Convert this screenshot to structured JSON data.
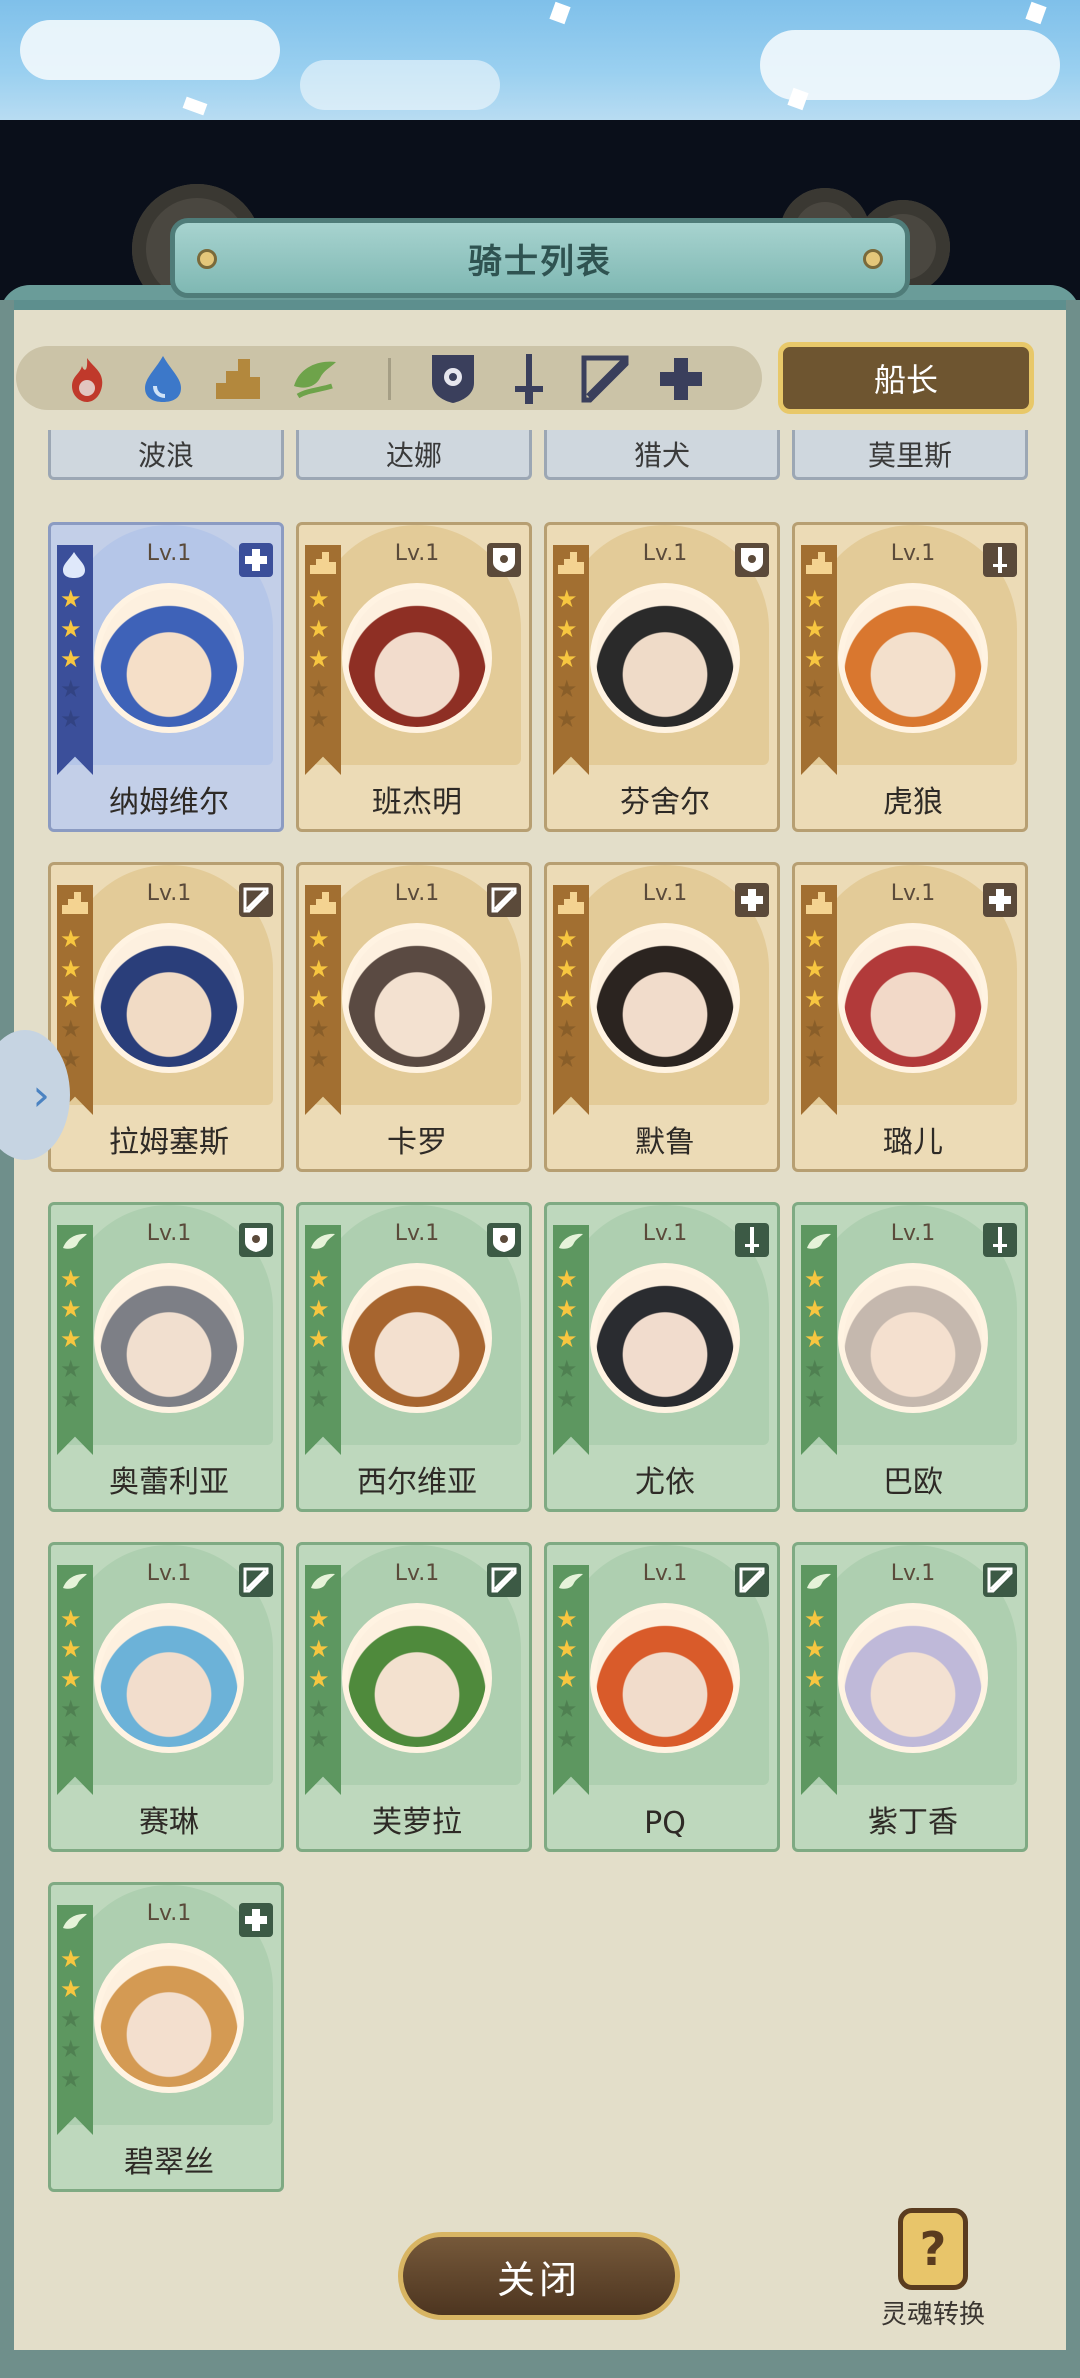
{
  "header": {
    "title": "骑士列表"
  },
  "filters": {
    "elements": [
      "fire-icon",
      "water-icon",
      "earth-icon",
      "wind-icon"
    ],
    "classes": [
      "shield-class-icon",
      "sword-class-icon",
      "bow-class-icon",
      "healer-class-icon"
    ]
  },
  "captain_label": "船长",
  "previous_row": [
    "波浪",
    "达娜",
    "猎犬",
    "莫里斯"
  ],
  "knights": [
    {
      "name": "纳姆维尔",
      "level": "Lv.1",
      "element": "water",
      "class": "healer",
      "stars": 3
    },
    {
      "name": "班杰明",
      "level": "Lv.1",
      "element": "earth",
      "class": "shield",
      "stars": 3
    },
    {
      "name": "芬舍尔",
      "level": "Lv.1",
      "element": "earth",
      "class": "shield",
      "stars": 3
    },
    {
      "name": "虎狼",
      "level": "Lv.1",
      "element": "earth",
      "class": "sword",
      "stars": 3
    },
    {
      "name": "拉姆塞斯",
      "level": "Lv.1",
      "element": "earth",
      "class": "bow",
      "stars": 3
    },
    {
      "name": "卡罗",
      "level": "Lv.1",
      "element": "earth",
      "class": "bow",
      "stars": 3
    },
    {
      "name": "默鲁",
      "level": "Lv.1",
      "element": "earth",
      "class": "healer",
      "stars": 3
    },
    {
      "name": "璐儿",
      "level": "Lv.1",
      "element": "earth",
      "class": "healer",
      "stars": 3
    },
    {
      "name": "奥蕾利亚",
      "level": "Lv.1",
      "element": "wind",
      "class": "shield",
      "stars": 3
    },
    {
      "name": "西尔维亚",
      "level": "Lv.1",
      "element": "wind",
      "class": "shield",
      "stars": 3
    },
    {
      "name": "尤依",
      "level": "Lv.1",
      "element": "wind",
      "class": "sword",
      "stars": 3
    },
    {
      "name": "巴欧",
      "level": "Lv.1",
      "element": "wind",
      "class": "sword",
      "stars": 3
    },
    {
      "name": "赛琳",
      "level": "Lv.1",
      "element": "wind",
      "class": "bow",
      "stars": 3
    },
    {
      "name": "芙萝拉",
      "level": "Lv.1",
      "element": "wind",
      "class": "bow",
      "stars": 3
    },
    {
      "name": "PQ",
      "level": "Lv.1",
      "element": "wind",
      "class": "bow",
      "stars": 3
    },
    {
      "name": "紫丁香",
      "level": "Lv.1",
      "element": "wind",
      "class": "bow",
      "stars": 3
    },
    {
      "name": "碧翠丝",
      "level": "Lv.1",
      "element": "wind",
      "class": "healer",
      "stars": 2
    }
  ],
  "footer": {
    "close_label": "关闭",
    "soul_label": "灵魂转换"
  }
}
